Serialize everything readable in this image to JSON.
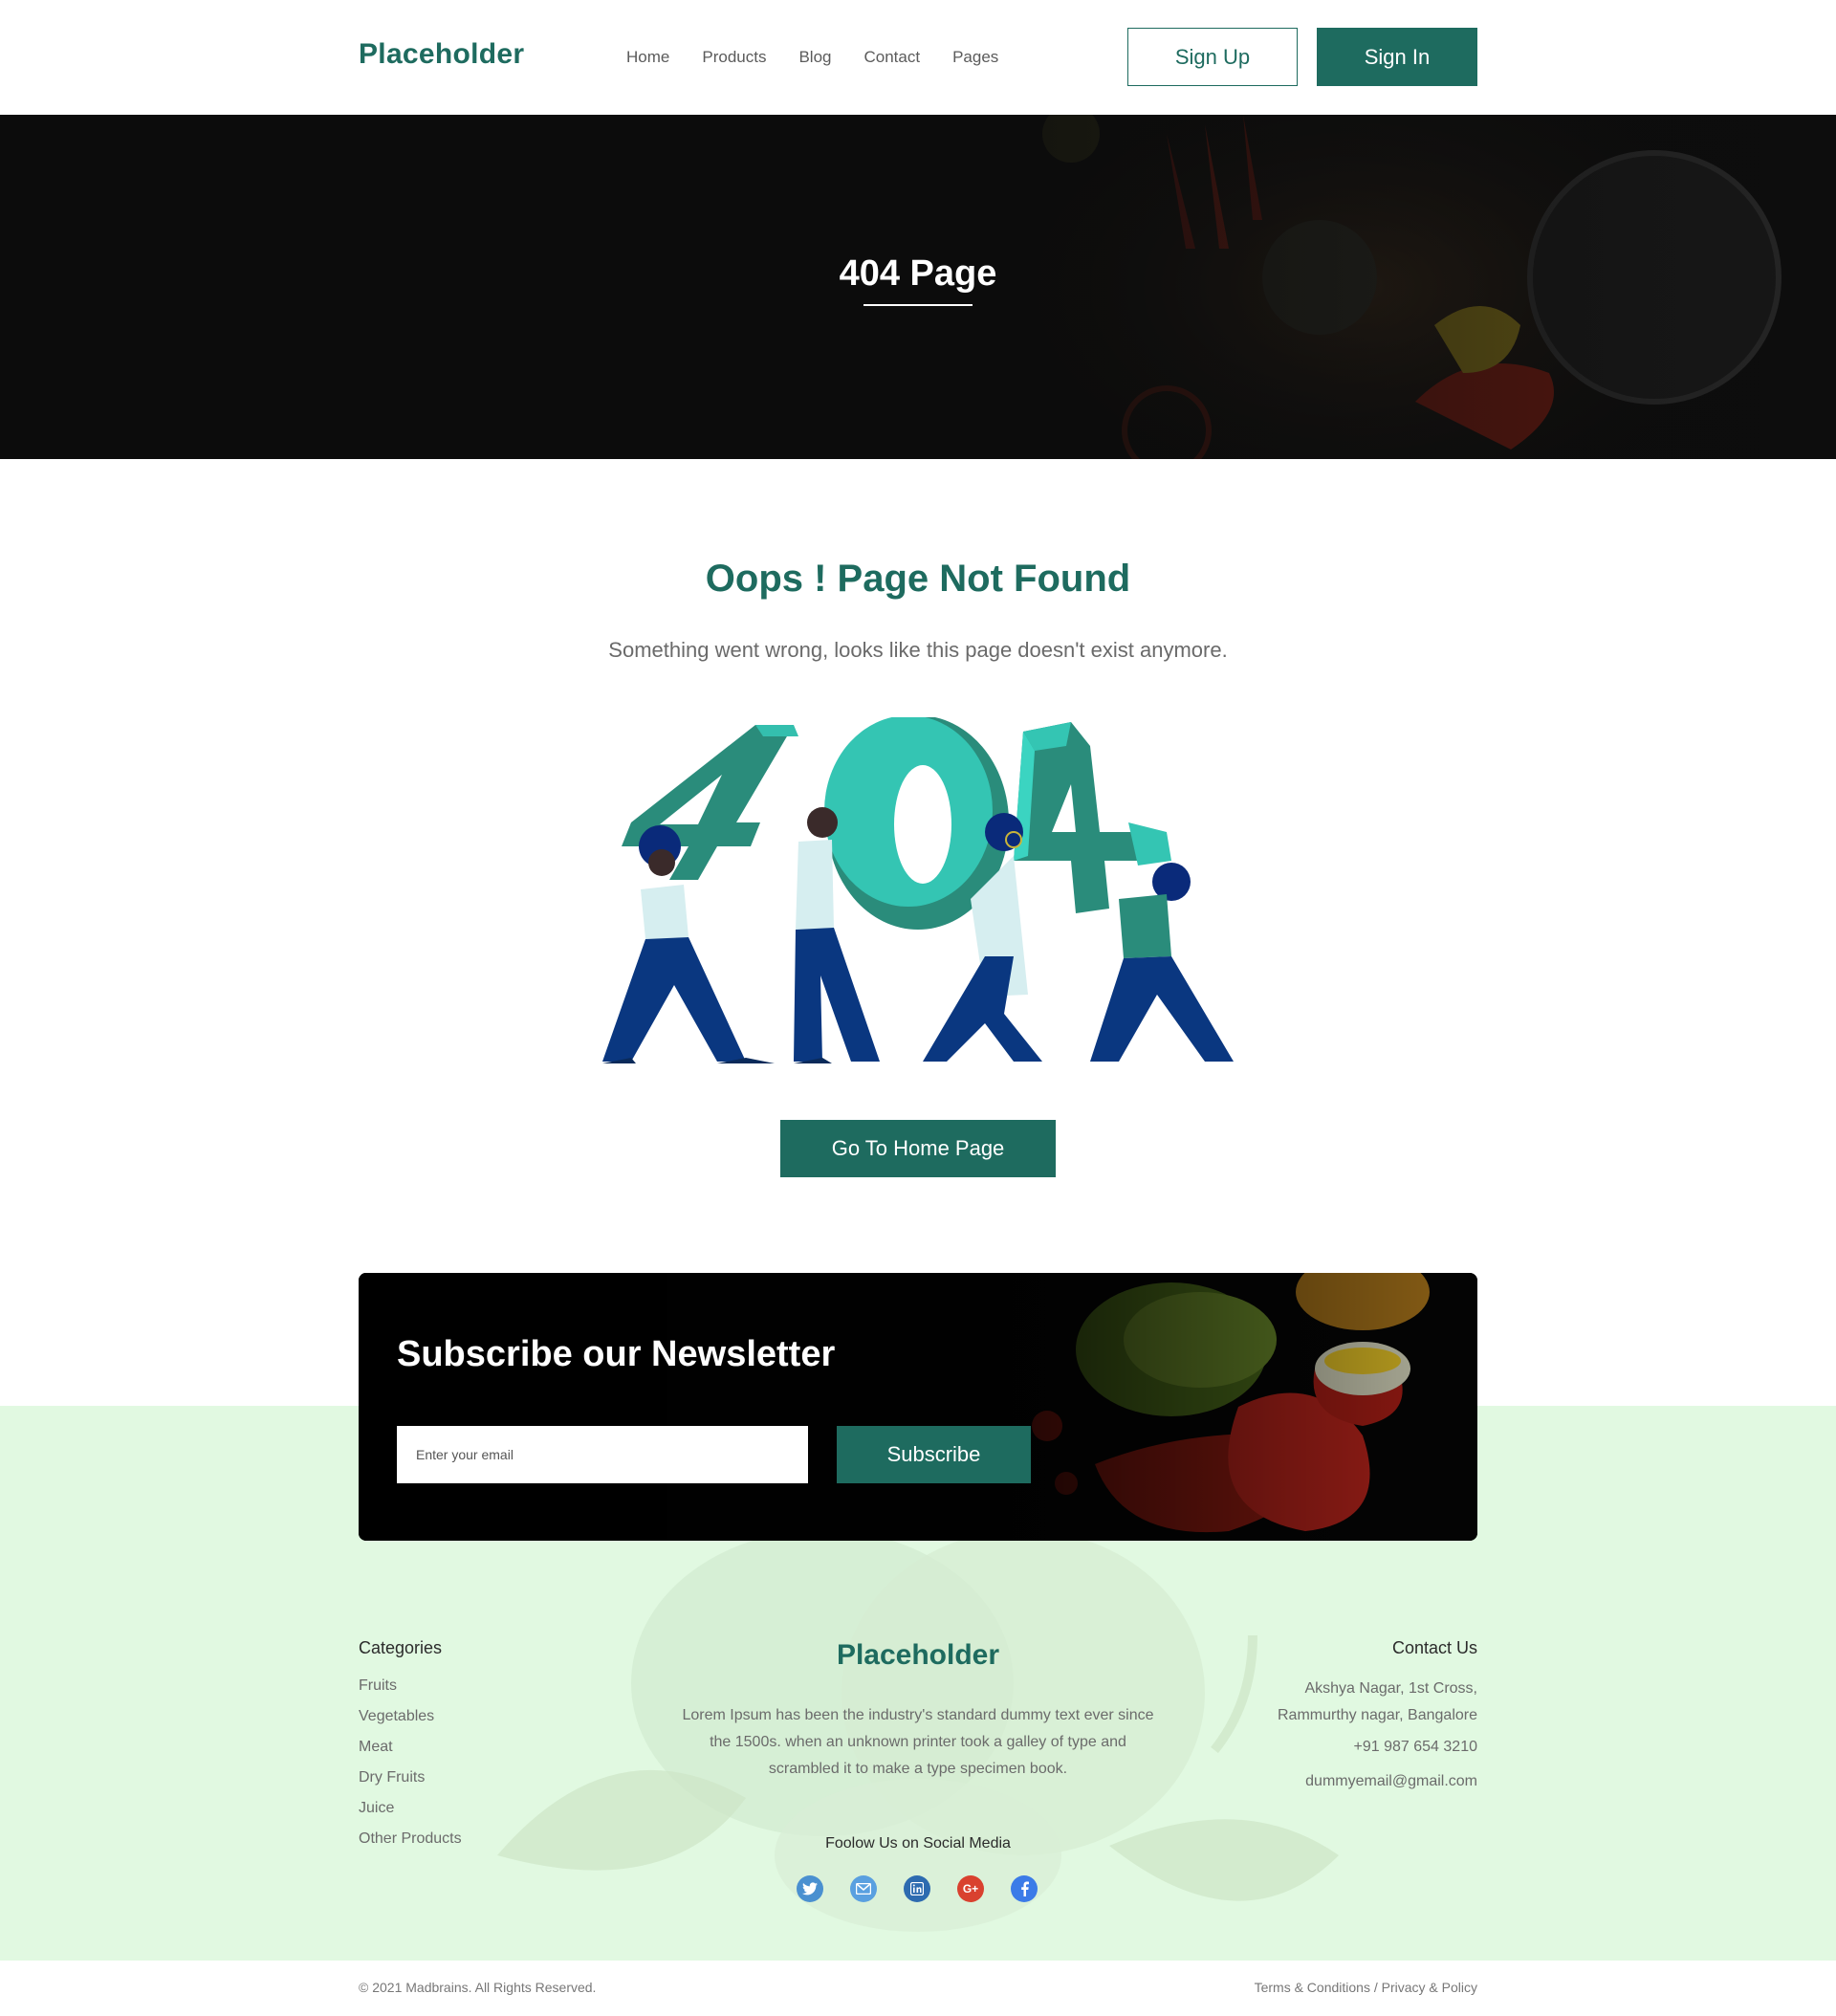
{
  "header": {
    "logo": "Placeholder",
    "nav": [
      "Home",
      "Products",
      "Blog",
      "Contact",
      "Pages"
    ],
    "signup_label": "Sign Up",
    "signin_label": "Sign In"
  },
  "hero": {
    "title": "404 Page"
  },
  "main": {
    "heading": "Oops ! Page Not Found",
    "subtext": "Something went wrong, looks like this page doesn't exist anymore.",
    "home_button": "Go To Home Page"
  },
  "newsletter": {
    "title": "Subscribe our Newsletter",
    "email_placeholder": "Enter your email",
    "subscribe_label": "Subscribe"
  },
  "footer": {
    "categories_heading": "Categories",
    "categories": [
      "Fruits",
      "Vegetables",
      "Meat",
      "Dry Fruits",
      "Juice",
      "Other Products"
    ],
    "logo": "Placeholder",
    "description": "Lorem Ipsum has been the industry's standard dummy text ever since the 1500s. when an unknown printer took a galley of type and scrambled it to make a type specimen book.",
    "follow_label": "Foolow Us on Social Media",
    "socials": [
      "twitter-icon",
      "mail-icon",
      "linkedin-icon",
      "google-plus-icon",
      "facebook-icon"
    ],
    "contact_heading": "Contact Us",
    "address_line1": "Akshya Nagar, 1st Cross,",
    "address_line2": "Rammurthy nagar, Bangalore",
    "phone": "+91 987 654 3210",
    "email": "dummyemail@gmail.com",
    "copyright": "© 2021 Madbrains. All Rights Reserved.",
    "terms": "Terms & Conditions",
    "separator": " / ",
    "privacy": "Privacy & Policy"
  },
  "colors": {
    "brand": "#1e6b5f",
    "footer_bg": "#e1f9e1",
    "hero_bg": "#0c0c0c"
  }
}
